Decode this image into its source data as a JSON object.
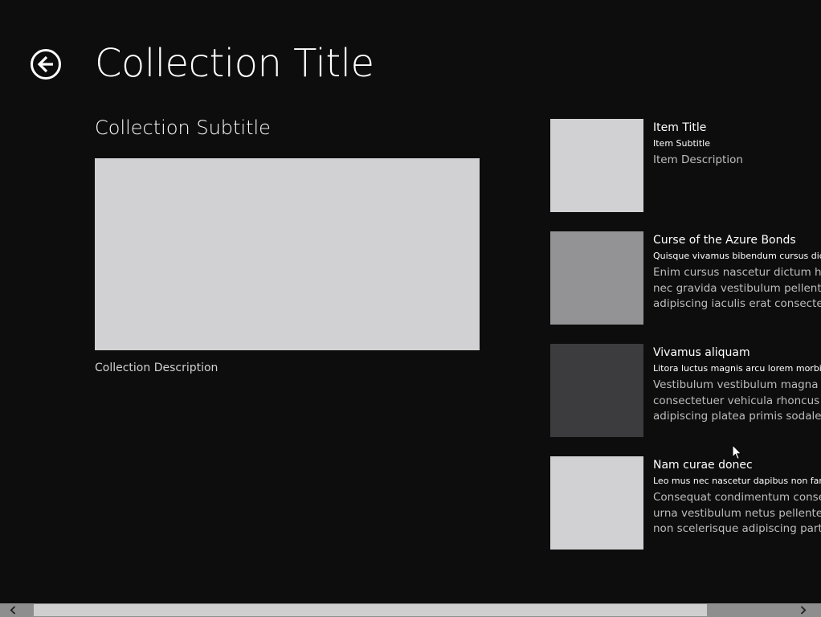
{
  "header": {
    "back_icon": "back-arrow-icon",
    "title": "Collection Title"
  },
  "collection": {
    "subtitle": "Collection Subtitle",
    "description": "Collection Description",
    "image_color": "#d1d1d3"
  },
  "items": [
    {
      "title": "Item Title",
      "subtitle": "Item Subtitle",
      "description": [
        "Item Description"
      ],
      "thumb_color": "#d1d1d3"
    },
    {
      "title": "Curse of the Azure Bonds",
      "subtitle": "Quisque vivamus bibendum cursus dict",
      "description": [
        "Enim cursus nascetur dictum habit",
        "nec gravida vestibulum pellentesq",
        "adipiscing iaculis erat consectetue"
      ],
      "thumb_color": "#939395"
    },
    {
      "title": "Vivamus aliquam",
      "subtitle": "Litora luctus magnis arcu lorem morbi b",
      "description": [
        "Vestibulum vestibulum magna sce",
        "consectetuer vehicula rhoncus pel",
        "adipiscing platea primis sodales pa"
      ],
      "thumb_color": "#3c3c3e"
    },
    {
      "title": "Nam curae donec",
      "subtitle": "Leo mus nec nascetur dapibus non fam",
      "description": [
        "Consequat condimentum consecte",
        "urna vestibulum netus pellentesqu",
        "non scelerisque adipiscing parturie"
      ],
      "thumb_color": "#d1d1d3"
    }
  ],
  "scrollbar": {
    "left_icon": "chevron-left-icon",
    "right_icon": "chevron-right-icon",
    "position_fraction": 0.0
  },
  "colors": {
    "background": "#0d0d0d",
    "scroll_track": "#8e8e8e",
    "scroll_thumb": "#cfcfcf"
  }
}
